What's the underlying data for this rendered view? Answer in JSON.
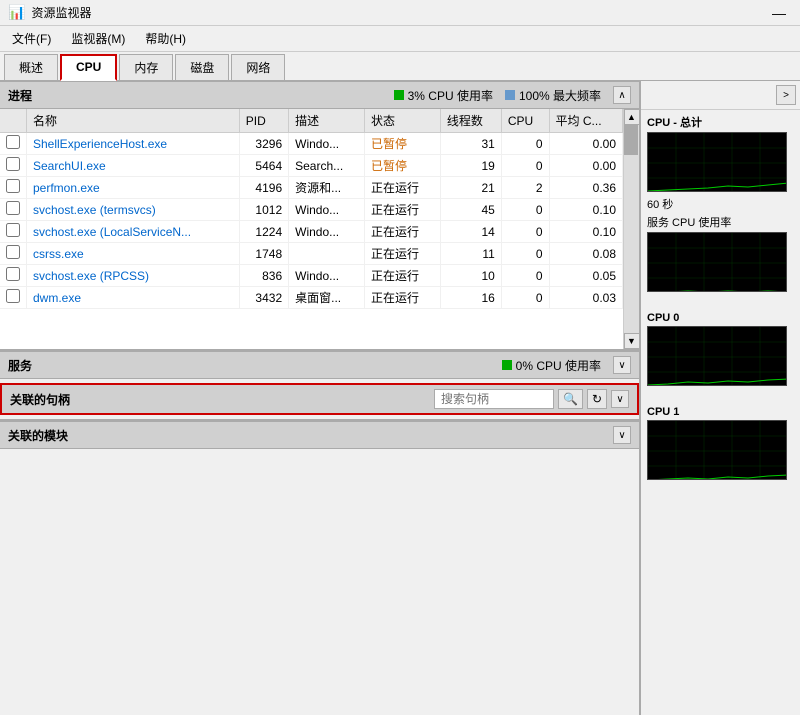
{
  "titleBar": {
    "title": "资源监视器",
    "closeBtn": "—"
  },
  "menuBar": {
    "items": [
      "文件(F)",
      "监视器(M)",
      "帮助(H)"
    ]
  },
  "tabs": [
    {
      "label": "概述"
    },
    {
      "label": "CPU",
      "active": true
    },
    {
      "label": "内存"
    },
    {
      "label": "磁盘"
    },
    {
      "label": "网络"
    }
  ],
  "processSection": {
    "title": "进程",
    "cpuUsage": "3% CPU 使用率",
    "maxFreq": "100% 最大频率",
    "columns": [
      "名称",
      "PID",
      "描述",
      "状态",
      "线程数",
      "CPU",
      "平均 C..."
    ],
    "rows": [
      {
        "checked": false,
        "name": "ShellExperienceHost.exe",
        "pid": "3296",
        "desc": "Windo...",
        "state": "已暂停",
        "threads": "31",
        "cpu": "0",
        "avgcpu": "0.00"
      },
      {
        "checked": false,
        "name": "SearchUI.exe",
        "pid": "5464",
        "desc": "Search...",
        "state": "已暂停",
        "threads": "19",
        "cpu": "0",
        "avgcpu": "0.00"
      },
      {
        "checked": false,
        "name": "perfmon.exe",
        "pid": "4196",
        "desc": "资源和...",
        "state": "正在运行",
        "threads": "21",
        "cpu": "2",
        "avgcpu": "0.36"
      },
      {
        "checked": false,
        "name": "svchost.exe (termsvcs)",
        "pid": "1012",
        "desc": "Windo...",
        "state": "正在运行",
        "threads": "45",
        "cpu": "0",
        "avgcpu": "0.10"
      },
      {
        "checked": false,
        "name": "svchost.exe (LocalServiceN...",
        "pid": "1224",
        "desc": "Windo...",
        "state": "正在运行",
        "threads": "14",
        "cpu": "0",
        "avgcpu": "0.10"
      },
      {
        "checked": false,
        "name": "csrss.exe",
        "pid": "1748",
        "desc": "",
        "state": "正在运行",
        "threads": "11",
        "cpu": "0",
        "avgcpu": "0.08"
      },
      {
        "checked": false,
        "name": "svchost.exe (RPCSS)",
        "pid": "836",
        "desc": "Windo...",
        "state": "正在运行",
        "threads": "10",
        "cpu": "0",
        "avgcpu": "0.05"
      },
      {
        "checked": false,
        "name": "dwm.exe",
        "pid": "3432",
        "desc": "桌面窗...",
        "state": "正在运行",
        "threads": "16",
        "cpu": "0",
        "avgcpu": "0.03"
      }
    ]
  },
  "servicesSection": {
    "title": "服务",
    "cpuUsage": "0% CPU 使用率"
  },
  "handlesSection": {
    "title": "关联的句柄",
    "searchPlaceholder": "搜索句柄",
    "searchBtnLabel": "🔍",
    "refreshBtnLabel": "↻"
  },
  "modulesSection": {
    "title": "关联的模块"
  },
  "rightPanel": {
    "toggleBtn": ">",
    "cpuTotal": {
      "title": "CPU - 总计",
      "subtitle": "60 秒",
      "serviceLabel": "服务 CPU 使用率"
    },
    "cpu0": {
      "title": "CPU 0"
    },
    "cpu1": {
      "title": "CPU 1"
    }
  }
}
